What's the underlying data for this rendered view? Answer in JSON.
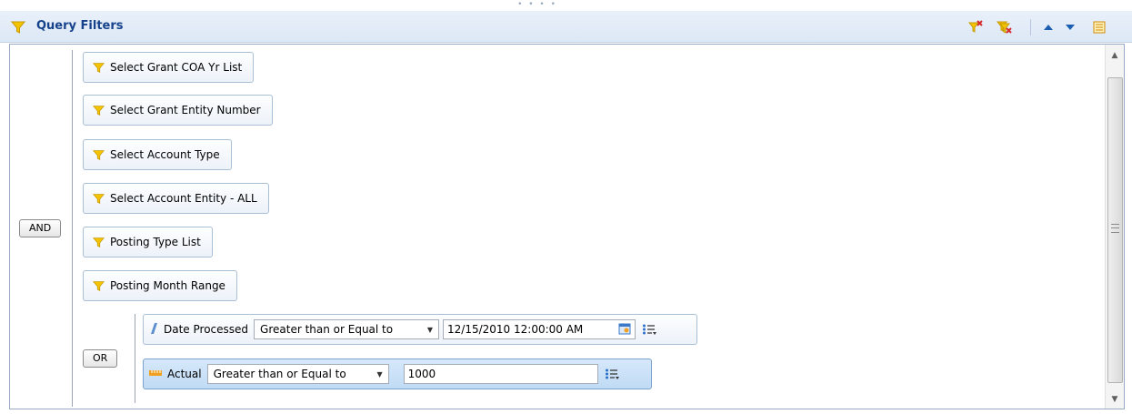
{
  "header": {
    "title": "Query Filters"
  },
  "toolbar": {
    "icons": [
      "add-filter-icon",
      "remove-all-filters-icon",
      "move-up-icon",
      "move-down-icon",
      "outline-view-icon"
    ]
  },
  "logic": {
    "root": "AND",
    "sub": "OR"
  },
  "filters": [
    {
      "label": "Select Grant COA Yr List"
    },
    {
      "label": "Select Grant Entity Number"
    },
    {
      "label": "Select Account Type"
    },
    {
      "label": "Select Account Entity - ALL"
    },
    {
      "label": "Posting Type List"
    },
    {
      "label": "Posting Month Range"
    }
  ],
  "conditions": [
    {
      "field": "Date Processed",
      "operator": "Greater than or Equal to",
      "value": "12/15/2010 12:00:00 AM"
    },
    {
      "field": "Actual",
      "operator": "Greater than or Equal to",
      "value": "1000"
    }
  ],
  "colors": {
    "accent": "#15428b",
    "funnel": "#f5c400",
    "header_bg": "#dde8f6",
    "selected_bg": "#c0dbf5"
  }
}
